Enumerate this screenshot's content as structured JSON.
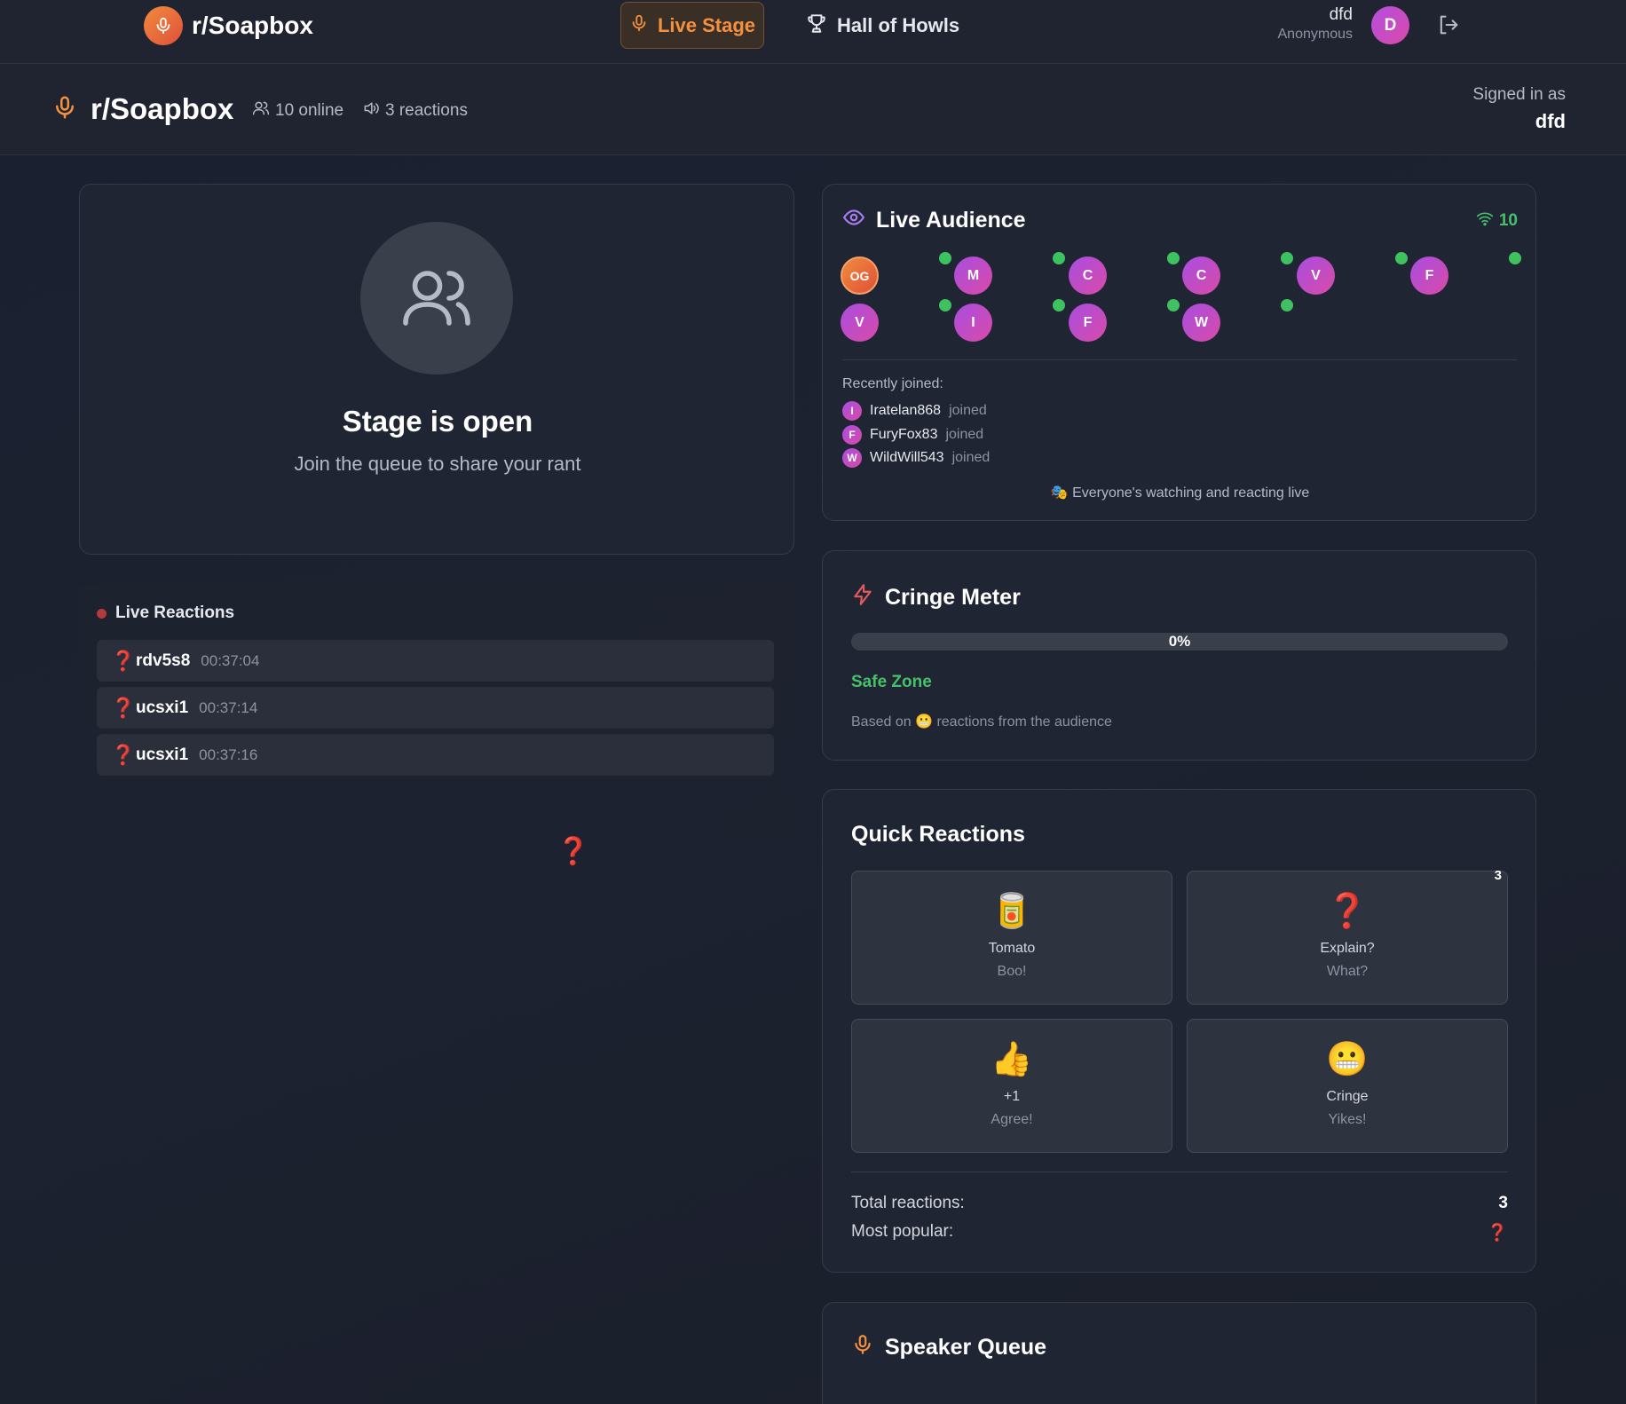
{
  "topbar": {
    "brand": "r/Soapbox",
    "nav_live": "Live Stage",
    "nav_hall": "Hall of Howls",
    "user_name": "dfd",
    "user_role": "Anonymous",
    "avatar_initial": "D"
  },
  "subbar": {
    "brand": "r/Soapbox",
    "online": "10 online",
    "reactions": "3 reactions",
    "signed_label": "Signed in as",
    "signed_name": "dfd"
  },
  "stage": {
    "title": "Stage is open",
    "subtitle": "Join the queue to share your rant"
  },
  "live_reactions": {
    "title": "Live Reactions",
    "items": [
      {
        "emoji": "❓",
        "user": "rdv5s8",
        "time": "00:37:04"
      },
      {
        "emoji": "❓",
        "user": "ucsxi1",
        "time": "00:37:14"
      },
      {
        "emoji": "❓",
        "user": "ucsxi1",
        "time": "00:37:16"
      }
    ],
    "floating_emoji": "❓"
  },
  "audience": {
    "title": "Live Audience",
    "count": "10",
    "members": [
      "OG",
      "M",
      "C",
      "C",
      "V",
      "F",
      "V",
      "I",
      "F",
      "W"
    ],
    "recent_label": "Recently joined:",
    "recent": [
      {
        "initial": "I",
        "name": "Iratelan868",
        "status": "joined"
      },
      {
        "initial": "F",
        "name": "FuryFox83",
        "status": "joined"
      },
      {
        "initial": "W",
        "name": "WildWill543",
        "status": "joined"
      }
    ],
    "footer": "🎭 Everyone's watching and reacting live"
  },
  "cringe": {
    "title": "Cringe Meter",
    "percent_label": "0%",
    "level": 0,
    "zone": "Safe Zone",
    "based_prefix": "Based on",
    "based_emoji": "😬",
    "based_suffix": "reactions from the audience"
  },
  "quick": {
    "title": "Quick Reactions",
    "buttons": [
      {
        "emoji": "🥫",
        "label": "Tomato",
        "sub": "Boo!",
        "count": ""
      },
      {
        "emoji": "❓",
        "label": "Explain?",
        "sub": "What?",
        "count": "3"
      },
      {
        "emoji": "👍",
        "label": "+1",
        "sub": "Agree!",
        "count": ""
      },
      {
        "emoji": "😬",
        "label": "Cringe",
        "sub": "Yikes!",
        "count": ""
      }
    ],
    "total_label": "Total reactions:",
    "total_value": "3",
    "popular_label": "Most popular:",
    "popular_value": "❓"
  },
  "queue": {
    "title": "Speaker Queue"
  },
  "colors": {
    "accent": "#f5913e",
    "online": "#47c06a",
    "avatar_gradient": "#b44ee0"
  }
}
